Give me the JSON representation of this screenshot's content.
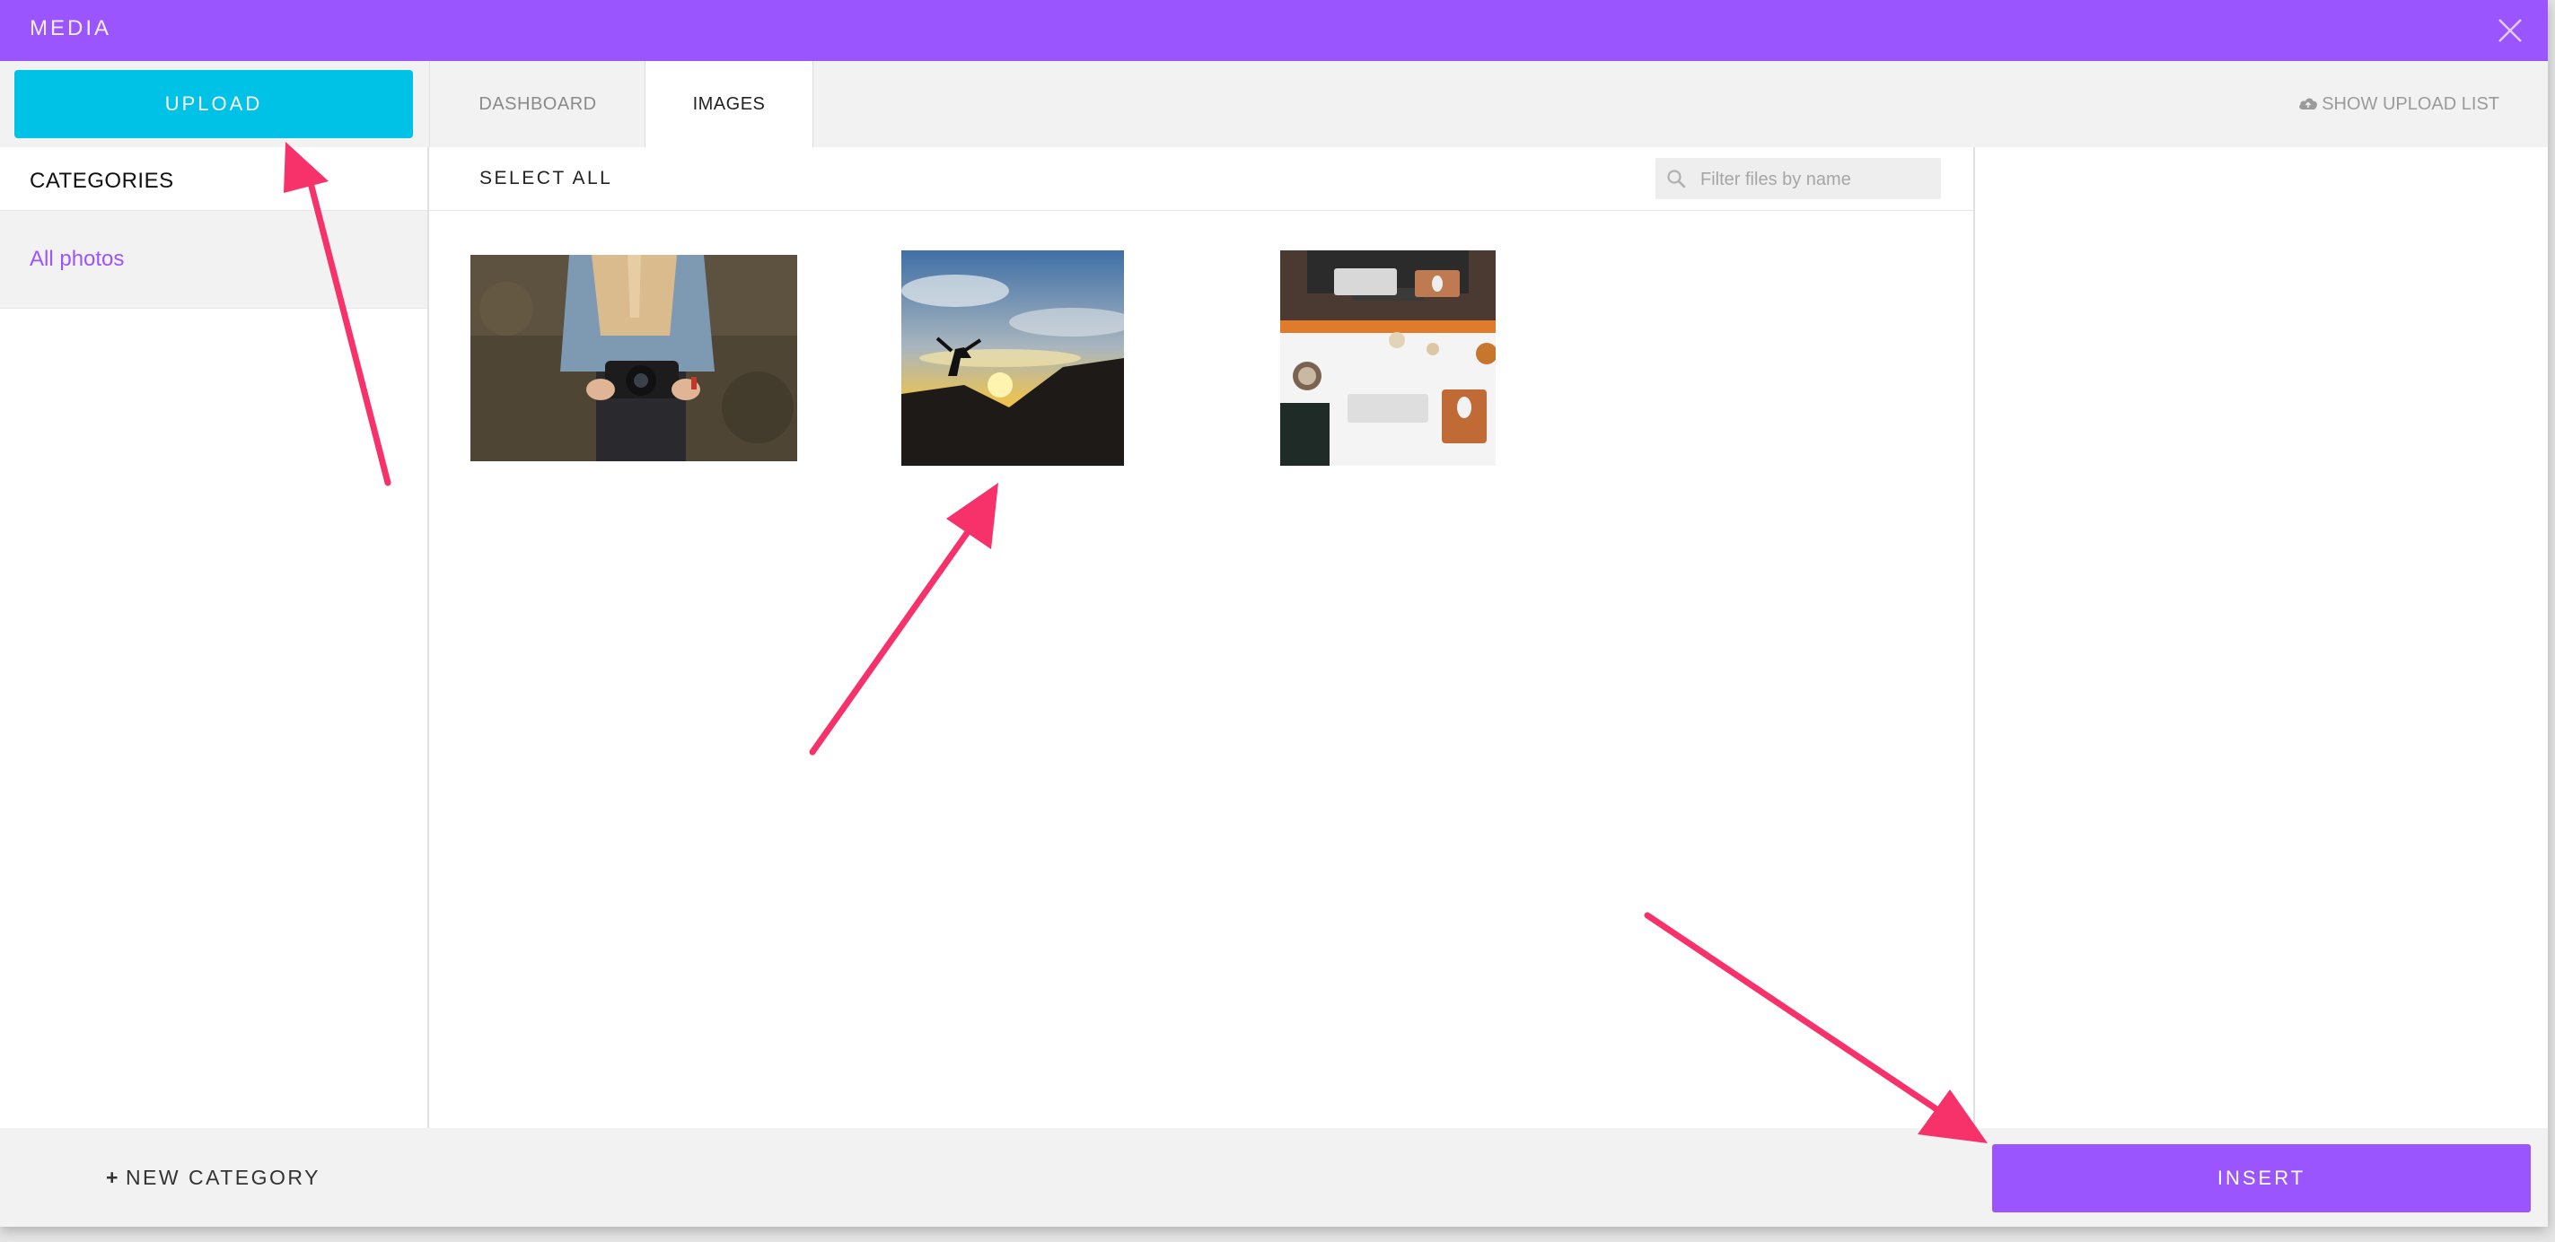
{
  "header": {
    "title": "MEDIA",
    "close_icon": "close-icon"
  },
  "toolbar": {
    "upload_label": "UPLOAD",
    "tabs": [
      {
        "label": "DASHBOARD",
        "active": false
      },
      {
        "label": "IMAGES",
        "active": true
      }
    ],
    "show_upload_list_label": "SHOW UPLOAD LIST",
    "show_upload_list_icon": "cloud-upload-icon"
  },
  "sidebar": {
    "heading": "CATEGORIES",
    "items": [
      {
        "label": "All photos",
        "active": true
      }
    ]
  },
  "content": {
    "select_all_label": "SELECT ALL",
    "filter": {
      "placeholder": "Filter files by name",
      "value": "",
      "icon": "search-icon"
    },
    "images": [
      {
        "subject": "woman holding camera"
      },
      {
        "subject": "person jumping at sunset"
      },
      {
        "subject": "desk workspace top view"
      }
    ]
  },
  "footer": {
    "new_category_label": "NEW CATEGORY",
    "insert_label": "INSERT"
  },
  "colors": {
    "accent": "#9a55ff",
    "upload": "#00c2e6",
    "arrow": "#f7326b",
    "link": "#9a55ff"
  }
}
